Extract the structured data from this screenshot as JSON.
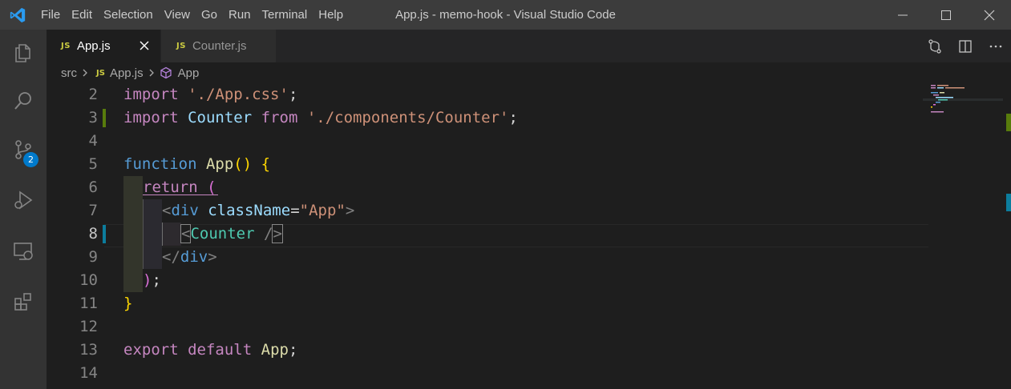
{
  "window": {
    "title": "App.js - memo-hook - Visual Studio Code"
  },
  "menu": [
    "File",
    "Edit",
    "Selection",
    "View",
    "Go",
    "Run",
    "Terminal",
    "Help"
  ],
  "activity_bar": {
    "items": [
      {
        "name": "explorer-icon"
      },
      {
        "name": "search-icon"
      },
      {
        "name": "source-control-icon",
        "badge": "2"
      },
      {
        "name": "run-debug-icon"
      },
      {
        "name": "remote-explorer-icon"
      },
      {
        "name": "extensions-icon"
      }
    ]
  },
  "tabs": [
    {
      "icon": "JS",
      "label": "App.js",
      "active": true
    },
    {
      "icon": "JS",
      "label": "Counter.js",
      "active": false
    }
  ],
  "breadcrumb": {
    "folder": "src",
    "file_icon": "JS",
    "file": "App.js",
    "symbol": "App"
  },
  "editor": {
    "line_numbers": [
      "2",
      "3",
      "4",
      "5",
      "6",
      "7",
      "8",
      "9",
      "10",
      "11",
      "12",
      "13",
      "14"
    ],
    "current_line": "8",
    "code": {
      "l2": {
        "import": "import",
        "path": "'./App.css'",
        "semi": ";"
      },
      "l3": {
        "import": "import",
        "name": "Counter",
        "from": "from",
        "path": "'./components/Counter'",
        "semi": ";"
      },
      "l5": {
        "function": "function",
        "name": "App",
        "parens": "()",
        "brace": "{"
      },
      "l6": {
        "return": "return",
        "paren": "("
      },
      "l7": {
        "open": "<",
        "tag": "div",
        "attr": "className",
        "eq": "=",
        "value": "\"App\"",
        "close": ">"
      },
      "l8": {
        "open": "<",
        "tag": "Counter",
        "space": " ",
        "selfclose": "/",
        "close": ">"
      },
      "l9": {
        "open": "</",
        "tag": "div",
        "close": ">"
      },
      "l10": {
        "paren": ")",
        "semi": ";"
      },
      "l11": {
        "brace": "}"
      },
      "l13": {
        "export": "export",
        "default": "default",
        "name": "App",
        "semi": ";"
      }
    }
  },
  "colors": {
    "keyword_control": "#c586c0",
    "keyword": "#569cd6",
    "string": "#ce9178",
    "function": "#dcdcaa",
    "variable": "#9cdcfe",
    "component": "#4ec9b0",
    "accent": "#007acc",
    "git_modified": "#0c7d9d",
    "git_added": "#587c0c"
  }
}
